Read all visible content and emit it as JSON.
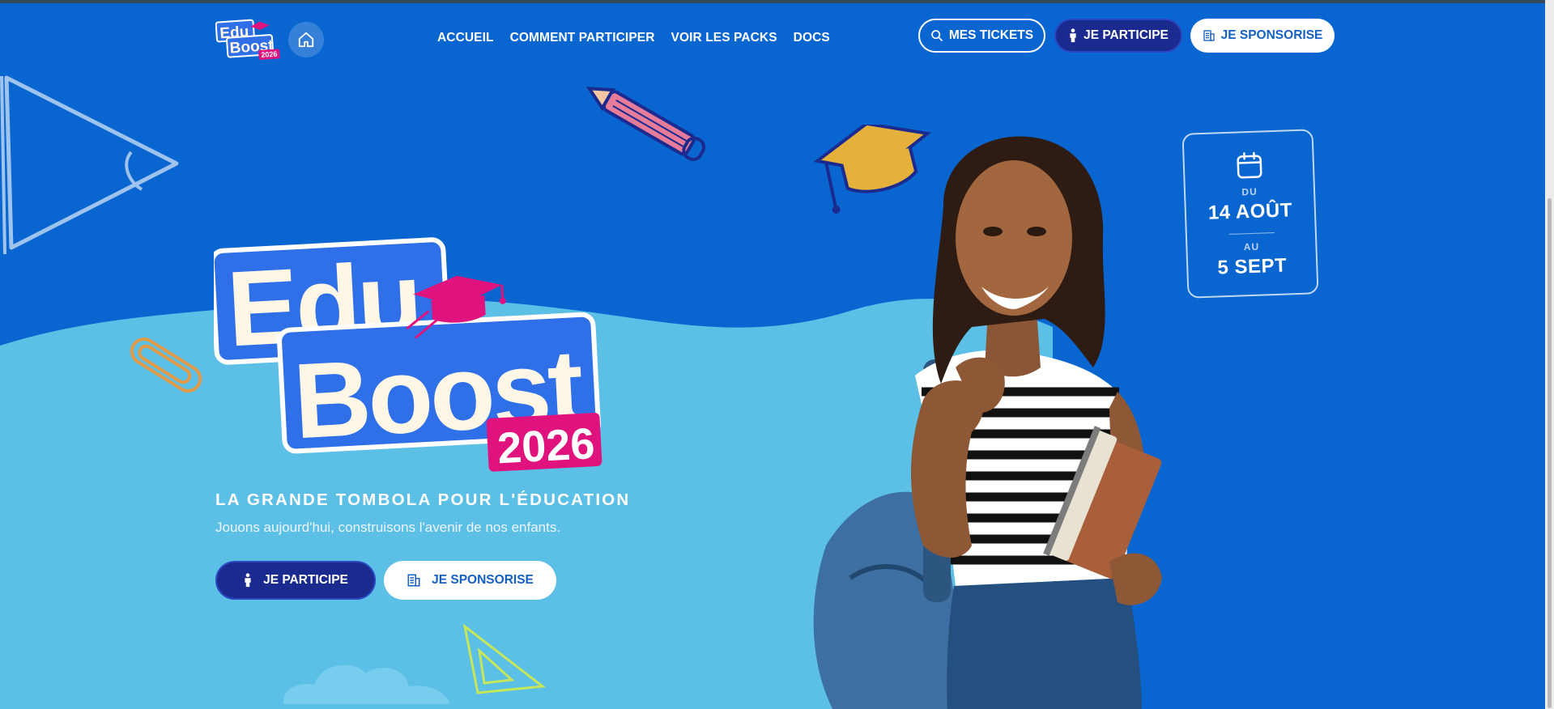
{
  "header": {
    "logo": {
      "line1": "Edu",
      "line2": "Boost",
      "year": "2026"
    },
    "nav": [
      "ACCUEIL",
      "COMMENT PARTICIPER",
      "VOIR LES PACKS",
      "DOCS"
    ],
    "buttons": {
      "tickets": "MES TICKETS",
      "participe": "JE PARTICIPE",
      "sponsorise": "JE SPONSORISE"
    }
  },
  "date_card": {
    "from_label": "DU",
    "from_date": "14 AOÛT",
    "to_label": "AU",
    "to_date": "5 SEPT"
  },
  "hero": {
    "logo": {
      "line1": "Edu",
      "line2": "Boost",
      "year": "2026"
    },
    "tagline": "LA GRANDE TOMBOLA POUR L'ÉDUCATION",
    "subtitle": "Jouons aujourd'hui, construisons l'avenir de nos enfants.",
    "buttons": {
      "participe": "JE PARTICIPE",
      "sponsorise": "JE SPONSORISE"
    }
  },
  "colors": {
    "background_blue": "#0966d1",
    "light_blue": "#5bbfe6",
    "navy": "#1b2a8f",
    "pink": "#e0127e",
    "logo_blue": "#2f6fe8",
    "cream": "#fff7e6"
  },
  "icons": [
    "home-icon",
    "search-icon",
    "person-icon",
    "building-icon",
    "calendar-icon"
  ]
}
